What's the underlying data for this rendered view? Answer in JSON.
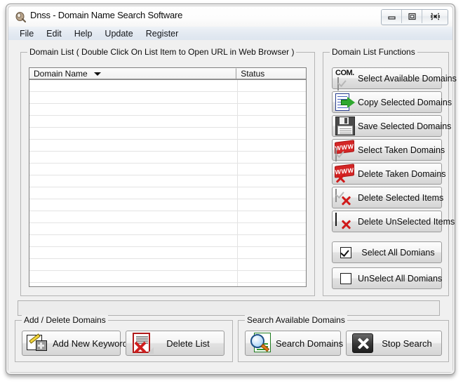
{
  "window": {
    "title": "Dnss - Domain Name Search Software",
    "app_icon": "app-magnifier-icon",
    "controls": {
      "minimize": "minimize-icon",
      "maximize": "maximize-icon",
      "close": "close-icon"
    }
  },
  "menu": {
    "items": [
      {
        "label": "File"
      },
      {
        "label": "Edit"
      },
      {
        "label": "Help"
      },
      {
        "label": "Update"
      },
      {
        "label": "Register"
      }
    ]
  },
  "domain_list": {
    "group_label": "Domain List ( Double Click On List Item to Open URL in Web Browser  )",
    "columns": [
      {
        "label": "Domain Name",
        "sort_indicator": "sort-descending-icon"
      },
      {
        "label": "Status"
      }
    ],
    "rows": [],
    "empty_row_count": 17
  },
  "functions": {
    "group_label": "Domain List Functions",
    "buttons": [
      {
        "label": "Select Available Domains",
        "icon": "com-checkbox-icon"
      },
      {
        "label": "Copy Selected Domains",
        "icon": "copy-icon"
      },
      {
        "label": "Save Selected Domains",
        "icon": "floppy-save-icon"
      },
      {
        "label": "Select Taken Domains",
        "icon": "www-banner-checkbox-icon"
      },
      {
        "label": "Delete Taken Domains",
        "icon": "www-banner-delete-icon"
      },
      {
        "label": "Delete Selected Items",
        "icon": "checked-box-delete-icon"
      },
      {
        "label": "Delete UnSelected Items",
        "icon": "unchecked-box-delete-icon"
      },
      {
        "label": "Select All Domians",
        "icon": "checked-box-icon"
      },
      {
        "label": "UnSelect All Domians",
        "icon": "unchecked-box-icon"
      }
    ]
  },
  "status_bar": {
    "text": ""
  },
  "add_delete": {
    "group_label": "Add / Delete Domains",
    "buttons": [
      {
        "label": "Add New Keywords",
        "icon": "edit-add-icon"
      },
      {
        "label": "Delete List",
        "icon": "delete-document-icon"
      }
    ]
  },
  "search": {
    "group_label": "Search Available Domains",
    "buttons": [
      {
        "label": "Search Domains",
        "icon": "magnifier-icon"
      },
      {
        "label": "Stop Search",
        "icon": "stop-x-icon"
      }
    ]
  },
  "colors": {
    "window_bg": "#f0f0f0",
    "menubar_bg": "#e4eaf2",
    "accent_red": "#d01a1a",
    "accent_green": "#2fa82f",
    "list_bg": "#ffffff",
    "border": "#b4b4b4"
  }
}
